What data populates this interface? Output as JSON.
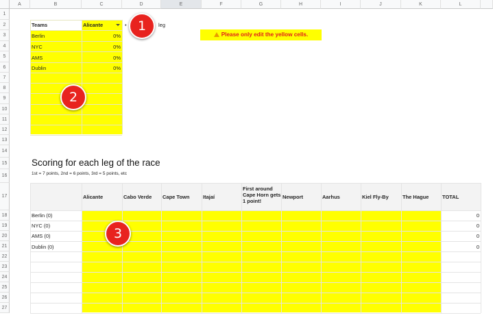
{
  "columns": [
    "A",
    "B",
    "C",
    "D",
    "E",
    "F",
    "G",
    "H",
    "I",
    "J",
    "K",
    "L"
  ],
  "rows": [
    "1",
    "2",
    "3",
    "4",
    "5",
    "6",
    "7",
    "8",
    "9",
    "10",
    "11",
    "12",
    "13",
    "14",
    "15",
    "16",
    "17",
    "18",
    "19",
    "20",
    "21",
    "22",
    "23",
    "24",
    "25",
    "26",
    "27"
  ],
  "teams_table": {
    "header_teams": "Teams",
    "header_leg": "Alicante",
    "rows": [
      {
        "team": "Berlin",
        "pct": "0%"
      },
      {
        "team": "NYC",
        "pct": "0%"
      },
      {
        "team": "AMS",
        "pct": "0%"
      },
      {
        "team": "Dublin",
        "pct": "0%"
      }
    ],
    "leg_suffix": "leg"
  },
  "notice": "Please only edit the yellow cells.",
  "section": {
    "title": "Scoring for each leg of the race",
    "subtitle": "1st = 7 points, 2nd = 6 points, 3rd = 5 points, etc"
  },
  "scoring_table": {
    "headers": [
      "Alicante",
      "Cabo Verde",
      "Cape Town",
      "Itajaí",
      "First around Cape Horn gets 1 point!",
      "Newport",
      "Aarhus",
      "Kiel Fly-By",
      "The Hague",
      "TOTAL"
    ],
    "rows": [
      {
        "team": "Berlin (0)",
        "total": "0"
      },
      {
        "team": "NYC (0)",
        "total": "0"
      },
      {
        "team": "AMS (0)",
        "total": "0"
      },
      {
        "team": "Dublin (0)",
        "total": "0"
      }
    ]
  },
  "markers": [
    "1",
    "2",
    "3"
  ],
  "colors": {
    "highlight": "#ffff00",
    "marker": "#e8231f",
    "notice_text": "#e0201a"
  }
}
